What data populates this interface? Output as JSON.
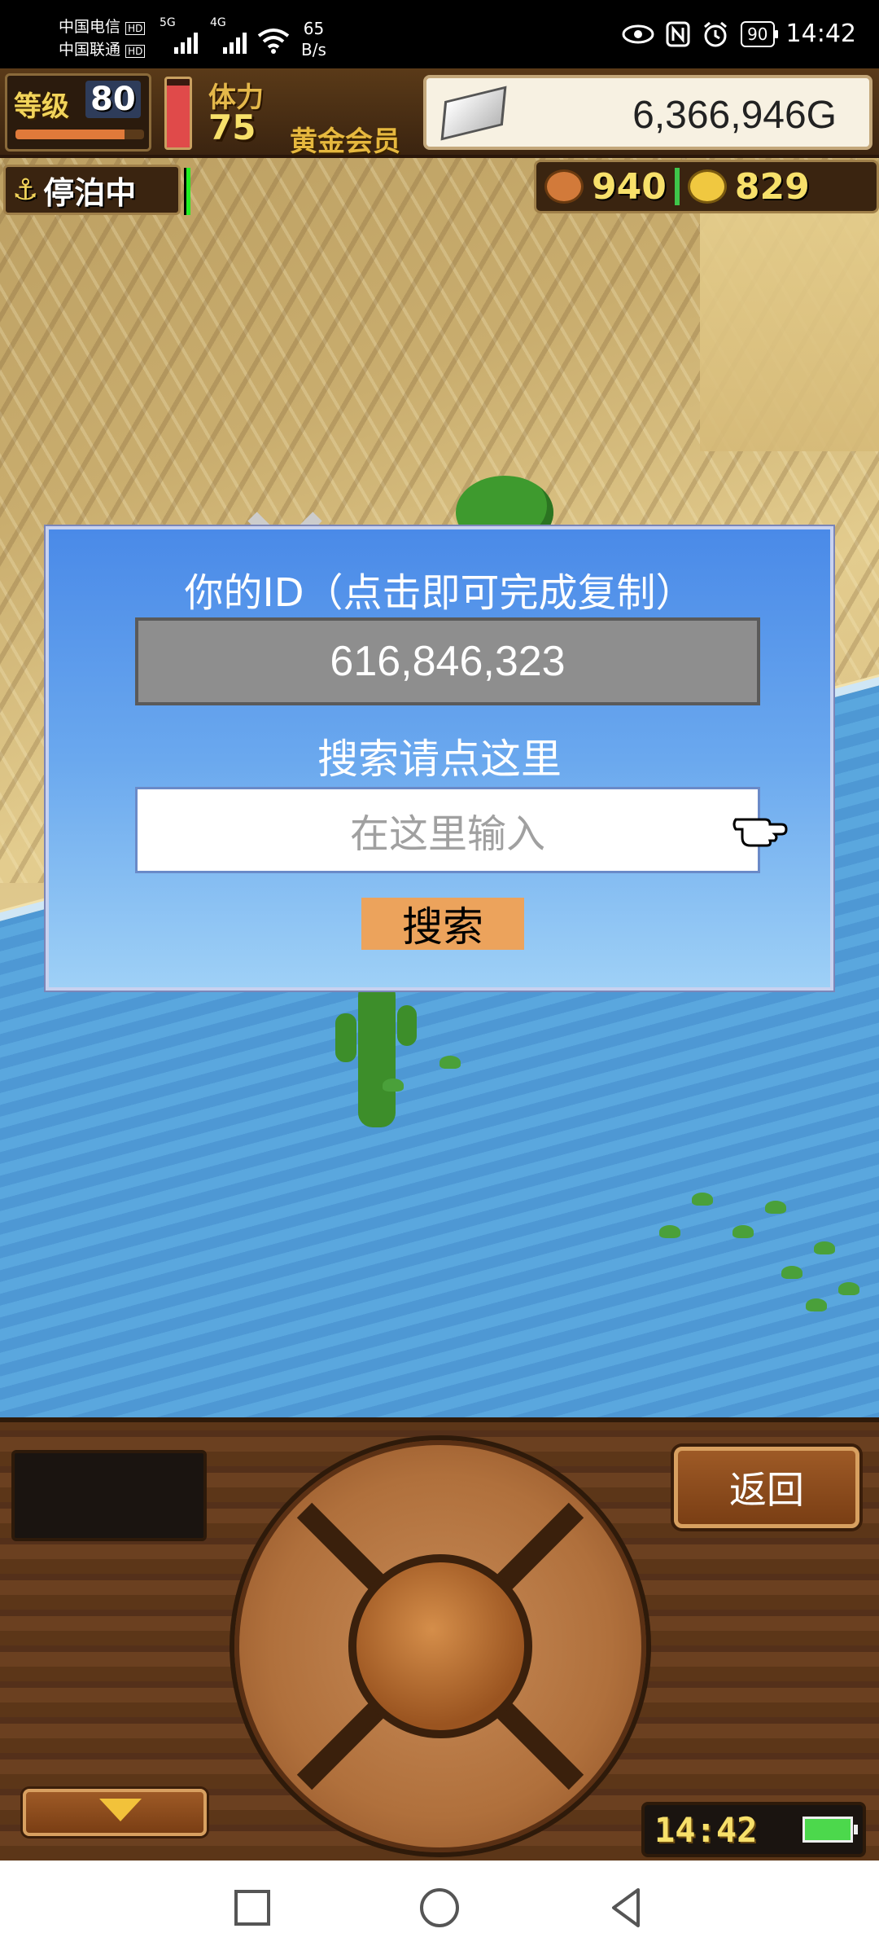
{
  "status_bar": {
    "carrier_1": "中国电信",
    "carrier_2": "中国联通",
    "hd_badge": "HD",
    "net_1": "5G",
    "net_2": "4G",
    "speed_value": "65",
    "speed_unit": "B/s",
    "battery": "90",
    "time": "14:42"
  },
  "hud": {
    "level_label": "等级",
    "level_value": "80",
    "level_progress": 0.85,
    "stamina_label": "体力",
    "stamina_value": "75",
    "stamina_fill": 0.9,
    "membership": "黄金会员",
    "gold_amount": "6,366,946G",
    "dock_status": "停泊中",
    "food_count": "940",
    "coin_count": "829"
  },
  "dialog": {
    "title": "你的ID（点击即可完成复制）",
    "user_id": "616,846,323",
    "search_hint": "搜索请点这里",
    "search_placeholder": "在这里输入",
    "search_button": "搜索"
  },
  "panel": {
    "back_button": "返回",
    "clock": "14:42"
  },
  "colors": {
    "dialog_top": "#4a8ae8",
    "dialog_bottom": "#9ed0f6",
    "search_button": "#eca35c",
    "id_box": "#8e8e8e"
  }
}
